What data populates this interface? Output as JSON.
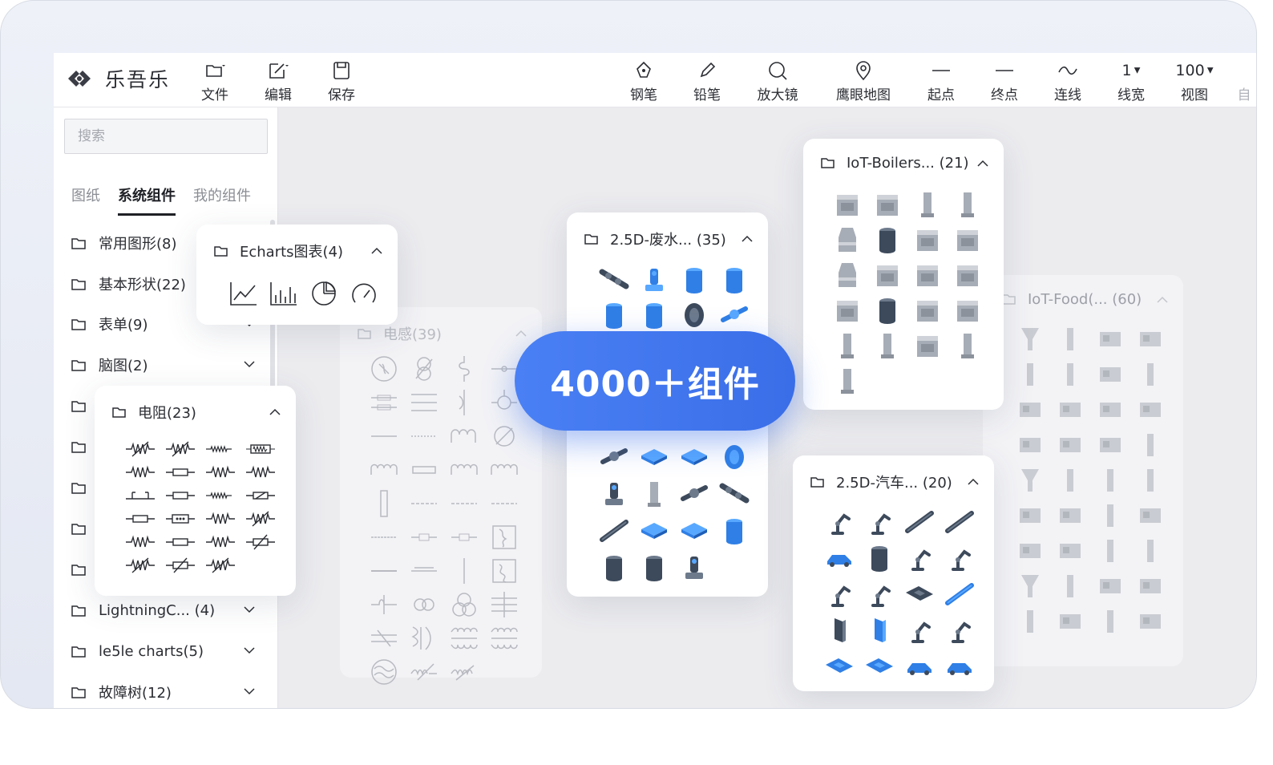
{
  "app": {
    "name": "乐吾乐"
  },
  "toolbar": {
    "file": "文件",
    "edit": "编辑",
    "save": "保存",
    "pen": "钢笔",
    "pencil": "铅笔",
    "magnifier": "放大镜",
    "minimap": "鹰眼地图",
    "start": "起点",
    "end": "终点",
    "connect": "连线",
    "line_width_value": "1",
    "line_width": "线宽",
    "zoom_value": "100",
    "view": "视图",
    "more": "自"
  },
  "sidebar": {
    "search_placeholder": "搜索",
    "tabs": [
      "图纸",
      "系统组件",
      "我的组件"
    ],
    "categories": [
      "常用图形(8)",
      "基本形状(22)",
      "表单(9)",
      "脑图(2)",
      "LightningC... (4)",
      "le5le charts(5)",
      "故障树(12)"
    ]
  },
  "panels": {
    "echarts": {
      "title": "Echarts图表(4)"
    },
    "resistor": {
      "title": "电阻(23)"
    },
    "inductor": {
      "title": "电感(39)"
    },
    "wastewater": {
      "title": "2.5D-废水... (35)"
    },
    "boilers": {
      "title": "IoT-Boilers... (21)"
    },
    "food": {
      "title": "IoT-Food(... (60)"
    },
    "car": {
      "title": "2.5D-汽车... (20)"
    }
  },
  "badge": {
    "text": "4000＋组件"
  },
  "colors": {
    "accent": "#3a6ee8",
    "panel_bg": "#ffffff",
    "text": "#2b2d33"
  }
}
